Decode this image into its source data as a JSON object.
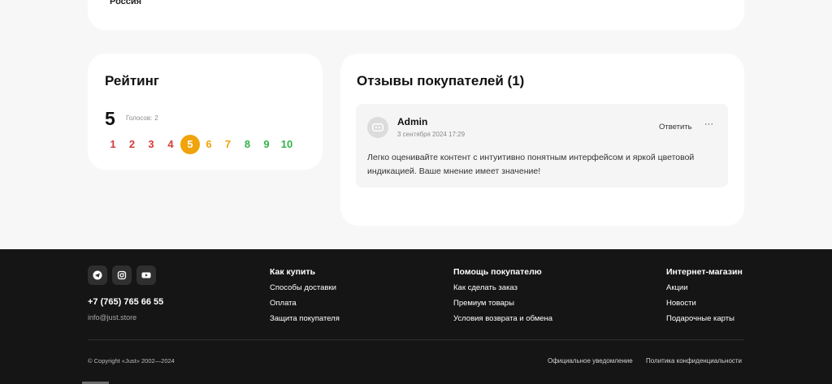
{
  "top_card": {
    "country": "Россия"
  },
  "rating": {
    "title": "Рейтинг",
    "value": "5",
    "votes_label": "Голосов:",
    "votes_count": "2",
    "scale": [
      {
        "label": "1",
        "color": "#d63a3a"
      },
      {
        "label": "2",
        "color": "#d63a3a"
      },
      {
        "label": "3",
        "color": "#d63a3a"
      },
      {
        "label": "4",
        "color": "#d63a3a"
      },
      {
        "label": "5",
        "color": "#f0a30a",
        "active": true
      },
      {
        "label": "6",
        "color": "#f0a30a"
      },
      {
        "label": "7",
        "color": "#f0a30a"
      },
      {
        "label": "8",
        "color": "#37b34a"
      },
      {
        "label": "9",
        "color": "#37b34a"
      },
      {
        "label": "10",
        "color": "#37b34a"
      }
    ],
    "active_color": "#f0a30a"
  },
  "reviews": {
    "title": "Отзывы покупателей (1)",
    "items": [
      {
        "author": "Admin",
        "date": "3 сентября 2024 17:29",
        "reply_label": "Ответить",
        "more_label": "···",
        "text": "Легко оценивайте контент с интуитивно понятным интерфейсом и яркой цветовой индикацией. Ваше мнение имеет значение!"
      }
    ]
  },
  "footer": {
    "socials": [
      "telegram-icon",
      "instagram-icon",
      "youtube-icon"
    ],
    "phone": "+7 (765) 765 66 55",
    "email": "info@just.store",
    "columns": [
      {
        "title": "Как купить",
        "links": [
          "Способы доставки",
          "Оплата",
          "Защита покупателя"
        ]
      },
      {
        "title": "Помощь покупателю",
        "links": [
          "Как сделать заказ",
          "Премиум товары",
          "Условия возврата и обмена"
        ]
      },
      {
        "title": "Интернет-магазин",
        "links": [
          "Акции",
          "Новости",
          "Подарочные карты"
        ]
      }
    ],
    "copyright": "© Copyright «Just» 2002—2024",
    "legal": [
      "Официальное уведомление",
      "Политика конфиденциальности"
    ]
  }
}
